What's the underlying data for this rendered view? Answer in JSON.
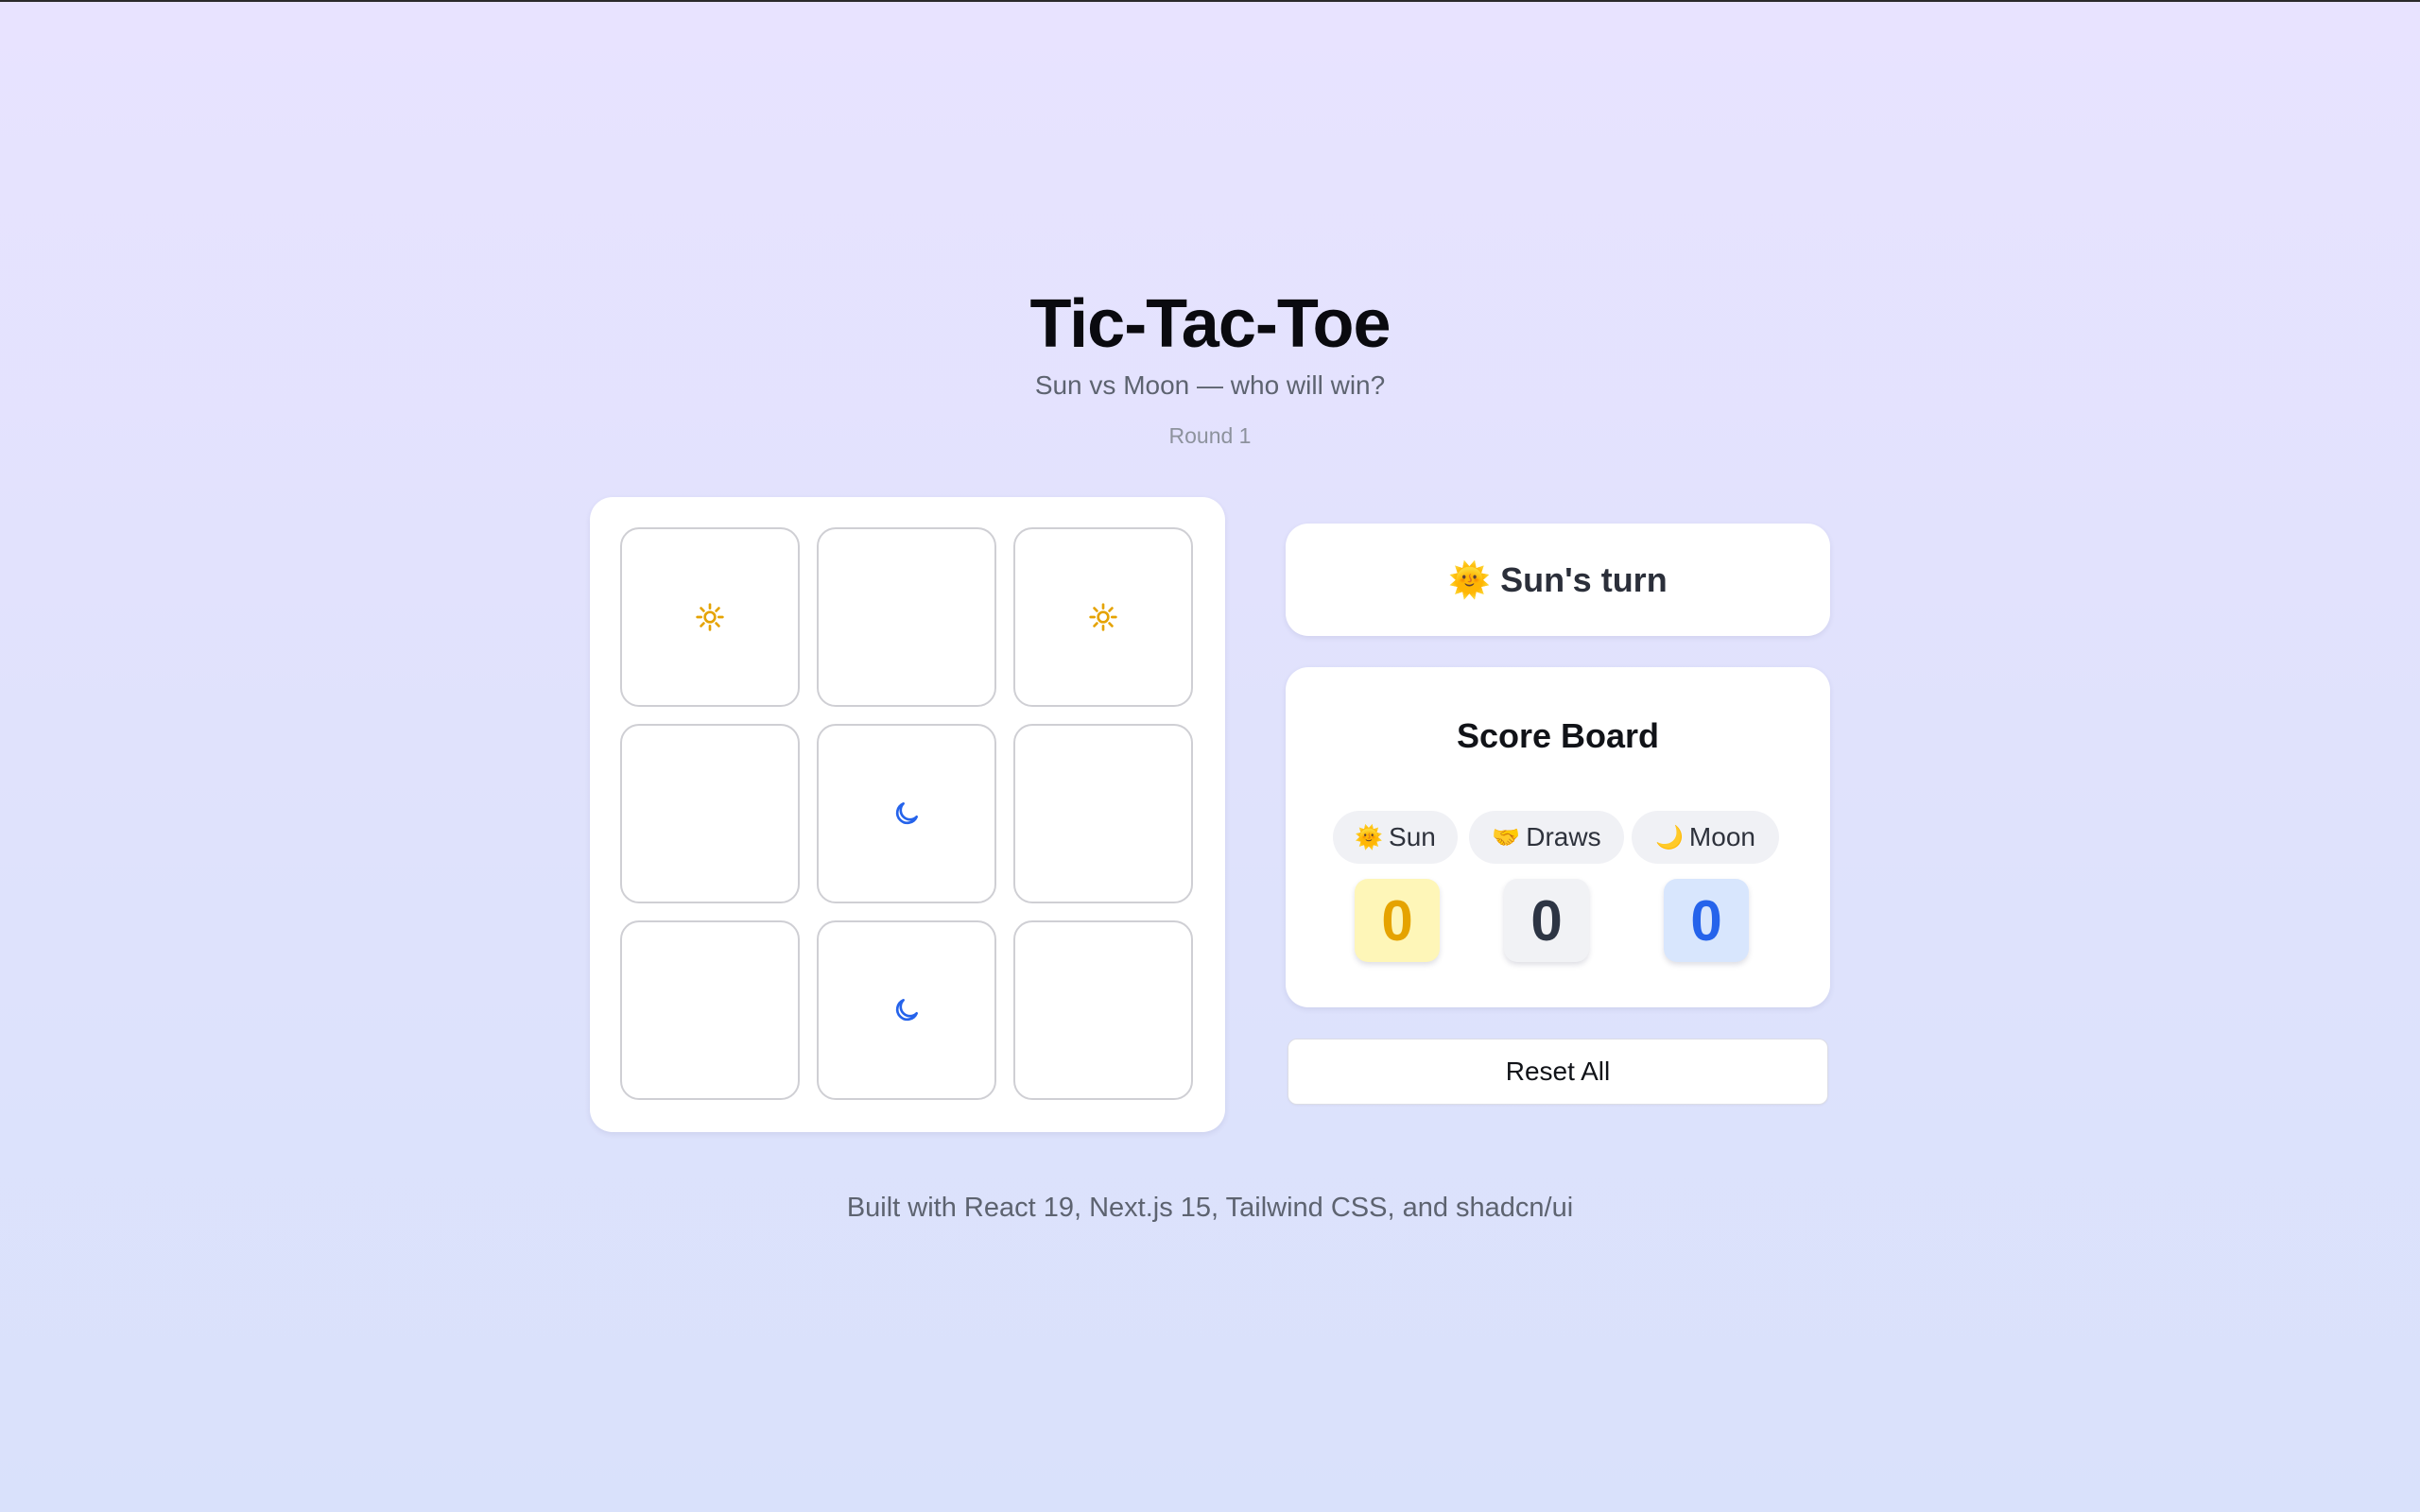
{
  "header": {
    "title": "Tic-Tac-Toe",
    "subtitle": "Sun vs Moon — who will win?",
    "round": "Round 1"
  },
  "board": {
    "cells": [
      "sun",
      "",
      "sun",
      "",
      "moon",
      "",
      "",
      "moon",
      ""
    ],
    "icons": {
      "sun": "sun-icon",
      "moon": "moon-icon"
    }
  },
  "status": {
    "emoji": "🌞",
    "turn_text": "Sun's turn"
  },
  "scoreboard": {
    "title": "Score Board",
    "sun": {
      "emoji": "🌞",
      "label": "Sun",
      "score": "0"
    },
    "draws": {
      "emoji": "🤝",
      "label": "Draws",
      "score": "0"
    },
    "moon": {
      "emoji": "🌙",
      "label": "Moon",
      "score": "0"
    }
  },
  "actions": {
    "reset_label": "Reset All"
  },
  "footer": {
    "text": "Built with React 19, Next.js 15, Tailwind CSS, and shadcn/ui"
  },
  "colors": {
    "sun": "#e5a300",
    "moon": "#2563eb",
    "draws": "#2d3544",
    "sun_box_bg": "#fef6b8",
    "draws_box_bg": "#f1f2f5",
    "moon_box_bg": "#d8e6fd"
  }
}
